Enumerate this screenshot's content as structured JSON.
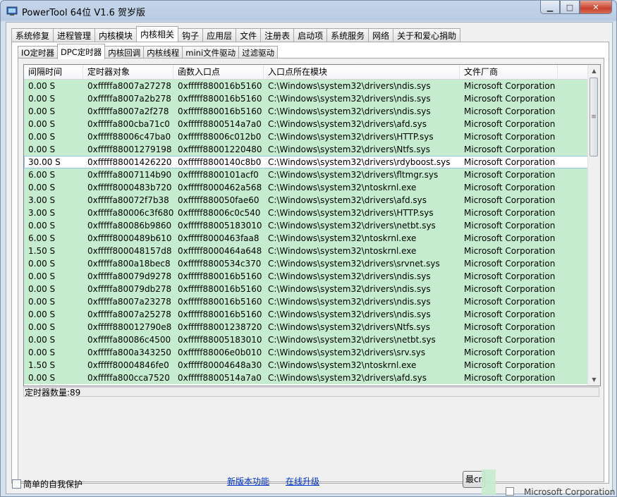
{
  "window": {
    "title": "PowerTool 64位 V1.6 贺岁版"
  },
  "main_tabs": [
    "系统修复",
    "进程管理",
    "内核模块",
    "内核相关",
    "钩子",
    "应用层",
    "文件",
    "注册表",
    "启动项",
    "系统服务",
    "网络",
    "关于和爱心捐助"
  ],
  "main_tab_active": "内核相关",
  "sub_tabs": [
    "IO定时器",
    "DPC定时器",
    "内核回调",
    "内核线程",
    "mini文件驱动",
    "过滤驱动"
  ],
  "sub_tab_active": "DPC定时器",
  "columns": [
    "间隔时间",
    "定时器对象",
    "函数入口点",
    "入口点所在模块",
    "文件厂商",
    ""
  ],
  "rows": [
    [
      "0.00 S",
      "0xfffffa8007a27278",
      "0xfffff880016b5160",
      "C:\\Windows\\system32\\drivers\\ndis.sys",
      "Microsoft Corporation"
    ],
    [
      "0.00 S",
      "0xfffffa8007a2b278",
      "0xfffff880016b5160",
      "C:\\Windows\\system32\\drivers\\ndis.sys",
      "Microsoft Corporation"
    ],
    [
      "0.00 S",
      "0xfffffa8007a2f278",
      "0xfffff880016b5160",
      "C:\\Windows\\system32\\drivers\\ndis.sys",
      "Microsoft Corporation"
    ],
    [
      "0.00 S",
      "0xfffffa800cba71c0",
      "0xfffff8800514a7a0",
      "C:\\Windows\\system32\\drivers\\afd.sys",
      "Microsoft Corporation"
    ],
    [
      "0.00 S",
      "0xfffff88006c47ba0",
      "0xfffff88006c012b0",
      "C:\\Windows\\system32\\drivers\\HTTP.sys",
      "Microsoft Corporation"
    ],
    [
      "0.00 S",
      "0xfffff88001279198",
      "0xfffff88001220480",
      "C:\\Windows\\system32\\drivers\\Ntfs.sys",
      "Microsoft Corporation"
    ],
    [
      "30.00 S",
      "0xfffff88001426220",
      "0xfffff8800140c8b0",
      "C:\\Windows\\system32\\drivers\\rdyboost.sys",
      "Microsoft Corporation"
    ],
    [
      "6.00 S",
      "0xfffffa8007114b90",
      "0xfffff8800101acf0",
      "C:\\Windows\\system32\\drivers\\fltmgr.sys",
      "Microsoft Corporation"
    ],
    [
      "0.00 S",
      "0xfffff8000483b720",
      "0xfffff8000462a568",
      "C:\\Windows\\system32\\ntoskrnl.exe",
      "Microsoft Corporation"
    ],
    [
      "3.00 S",
      "0xfffffa80072f7b38",
      "0xfffff880050fae60",
      "C:\\Windows\\system32\\drivers\\afd.sys",
      "Microsoft Corporation"
    ],
    [
      "3.00 S",
      "0xfffffa80006c3f680",
      "0xfffff88006c0c540",
      "C:\\Windows\\system32\\drivers\\HTTP.sys",
      "Microsoft Corporation"
    ],
    [
      "0.00 S",
      "0xfffffa80086b9860",
      "0xfffff88005183010",
      "C:\\Windows\\system32\\drivers\\netbt.sys",
      "Microsoft Corporation"
    ],
    [
      "6.00 S",
      "0xfffff8000489b610",
      "0xfffff8000463faa8",
      "C:\\Windows\\system32\\ntoskrnl.exe",
      "Microsoft Corporation"
    ],
    [
      "1.50 S",
      "0xfffff800048157d8",
      "0xfffff8000464a648",
      "C:\\Windows\\system32\\ntoskrnl.exe",
      "Microsoft Corporation"
    ],
    [
      "0.00 S",
      "0xfffffa800a18bec8",
      "0xfffff8800534c370",
      "C:\\Windows\\system32\\drivers\\srvnet.sys",
      "Microsoft Corporation"
    ],
    [
      "0.00 S",
      "0xfffffa80079d9278",
      "0xfffff880016b5160",
      "C:\\Windows\\system32\\drivers\\ndis.sys",
      "Microsoft Corporation"
    ],
    [
      "0.00 S",
      "0xfffffa80079db278",
      "0xfffff880016b5160",
      "C:\\Windows\\system32\\drivers\\ndis.sys",
      "Microsoft Corporation"
    ],
    [
      "0.00 S",
      "0xfffffa8007a23278",
      "0xfffff880016b5160",
      "C:\\Windows\\system32\\drivers\\ndis.sys",
      "Microsoft Corporation"
    ],
    [
      "0.00 S",
      "0xfffffa8007a25278",
      "0xfffff880016b5160",
      "C:\\Windows\\system32\\drivers\\ndis.sys",
      "Microsoft Corporation"
    ],
    [
      "0.00 S",
      "0xfffff880012790e8",
      "0xfffff88001238720",
      "C:\\Windows\\system32\\drivers\\Ntfs.sys",
      "Microsoft Corporation"
    ],
    [
      "0.00 S",
      "0xfffffa80086c4500",
      "0xfffff88005183010",
      "C:\\Windows\\system32\\drivers\\netbt.sys",
      "Microsoft Corporation"
    ],
    [
      "0.00 S",
      "0xfffffa800a343250",
      "0xfffff88006e0b010",
      "C:\\Windows\\system32\\drivers\\srv.sys",
      "Microsoft Corporation"
    ],
    [
      "1.50 S",
      "0xfffff80004846fe0",
      "0xfffff80004648a30",
      "C:\\Windows\\system32\\ntoskrnl.exe",
      "Microsoft Corporation"
    ],
    [
      "0.00 S",
      "0xfffffa800cca7520",
      "0xfffff8800514a7a0",
      "C:\\Windows\\system32\\drivers\\afd.sys",
      "Microsoft Corporation"
    ]
  ],
  "selected_row_index": 6,
  "status": {
    "timer_count": "定时器数量:89"
  },
  "footer": {
    "self_protect_label": "简单的自我保护",
    "new_features_link": "新版本功能",
    "online_upgrade_link": "在线升级",
    "button_label": "最cn",
    "ghost_vendor": "Microsoft Corporation"
  },
  "colors": {
    "row_bg": "#c5ecce",
    "link": "#0033cc",
    "close_btn": "#c8412b"
  },
  "icons": {
    "app": "powertool-app-icon",
    "minimize": "minimize-icon",
    "maximize": "maximize-icon",
    "close": "close-icon"
  }
}
